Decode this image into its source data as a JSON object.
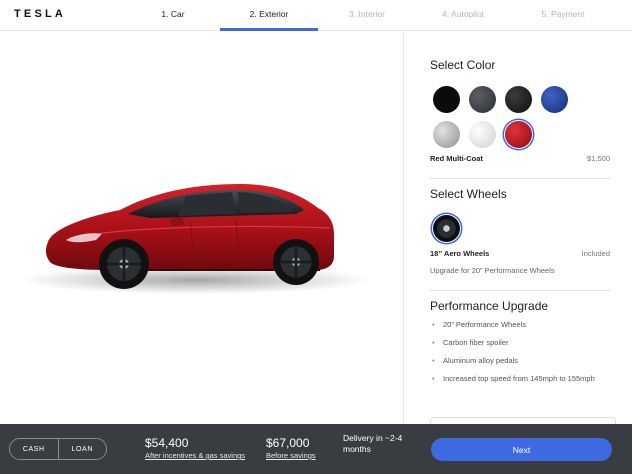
{
  "brand": "TESLA",
  "steps": [
    {
      "label": "1. Car",
      "state": "done"
    },
    {
      "label": "2. Exterior",
      "state": "active"
    },
    {
      "label": "3. Interior",
      "state": "pending"
    },
    {
      "label": "4. Autopilot",
      "state": "pending"
    },
    {
      "label": "5. Payment",
      "state": "pending"
    }
  ],
  "colors": {
    "title": "Select Color",
    "swatches": [
      {
        "name": "black-swatch",
        "hex": "#0b0b0c"
      },
      {
        "name": "midnight-silver-swatch",
        "hex": "#3a3d42"
      },
      {
        "name": "obsidian-black-swatch",
        "hex": "#1a1a1c"
      },
      {
        "name": "deep-blue-swatch",
        "hex": "#1e3d8f"
      },
      {
        "name": "silver-swatch",
        "hex": "#a9abae"
      },
      {
        "name": "pearl-white-swatch",
        "hex": "#e9e9e9"
      },
      {
        "name": "red-multi-coat-swatch",
        "hex": "#b3141b"
      }
    ],
    "selected_name": "Red Multi-Coat",
    "selected_price": "$1,500"
  },
  "wheels": {
    "title": "Select Wheels",
    "selected_name": "18” Aero Wheels",
    "selected_price": "Included",
    "upgrade_note": "Upgrade for 20” Performance Wheels"
  },
  "performance": {
    "title": "Performance Upgrade",
    "items": [
      "20” Performance Wheels",
      "Carbon fiber spoiler",
      "Aluminum alloy pedals",
      "Increased top speed from 145mph to 155mph"
    ]
  },
  "footer": {
    "cash_label": "CASH",
    "loan_label": "LOAN",
    "price_after": "$54,400",
    "price_after_link": "After incentives & gas savings",
    "price_before": "$67,000",
    "price_before_link": "Before savings",
    "delivery": "Delivery in ~2-4 months",
    "next_label": "Next"
  },
  "accent_color": "#3e6ae1"
}
